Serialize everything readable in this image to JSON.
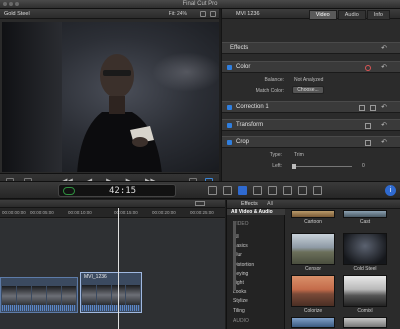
{
  "app": {
    "title": "Final Cut Pro"
  },
  "viewer": {
    "clip_name": "Gold Steel",
    "fit": "Fit:  24%",
    "timecode": "42:15"
  },
  "inspector": {
    "clip": "MVI 1236",
    "tabs": [
      {
        "label": "Video",
        "active": true
      },
      {
        "label": "Audio",
        "active": false
      },
      {
        "label": "Info",
        "active": false
      }
    ],
    "effects_label": "Effects",
    "color_label": "Color",
    "balance_label": "Balance:",
    "balance_value": "Not Analyzed",
    "match_color_label": "Match Color:",
    "choose_label": "Choose...",
    "correction_label": "Correction 1",
    "transform_label": "Transform",
    "crop_label": "Crop",
    "type_label": "Type:",
    "type_value": "Trim",
    "left_label": "Left:",
    "left_value": "0"
  },
  "timeline": {
    "ruler": [
      "00:00:00:00",
      "00:00:05:00",
      "00:00:10:00",
      "00:00:15:00",
      "00:00:20:00",
      "00:00:25:00"
    ],
    "clip_name": "MVI_1236"
  },
  "effects_browser": {
    "title": "Effects",
    "filter": "All",
    "categories": [
      {
        "label": "All Video & Audio",
        "selected": true
      },
      {
        "label": "VIDEO",
        "header": true
      },
      {
        "label": "All"
      },
      {
        "label": "Basics"
      },
      {
        "label": "Blur"
      },
      {
        "label": "Distortion"
      },
      {
        "label": "Keying"
      },
      {
        "label": "Light"
      },
      {
        "label": "Looks"
      },
      {
        "label": "Stylize"
      },
      {
        "label": "Tiling"
      },
      {
        "label": "AUDIO",
        "header": true
      }
    ],
    "tiles": [
      {
        "label": "Cartoon"
      },
      {
        "label": "Cast"
      },
      {
        "label": "Censor"
      },
      {
        "label": "Cold Steel"
      },
      {
        "label": "Colorize"
      },
      {
        "label": "Comixl"
      }
    ]
  }
}
